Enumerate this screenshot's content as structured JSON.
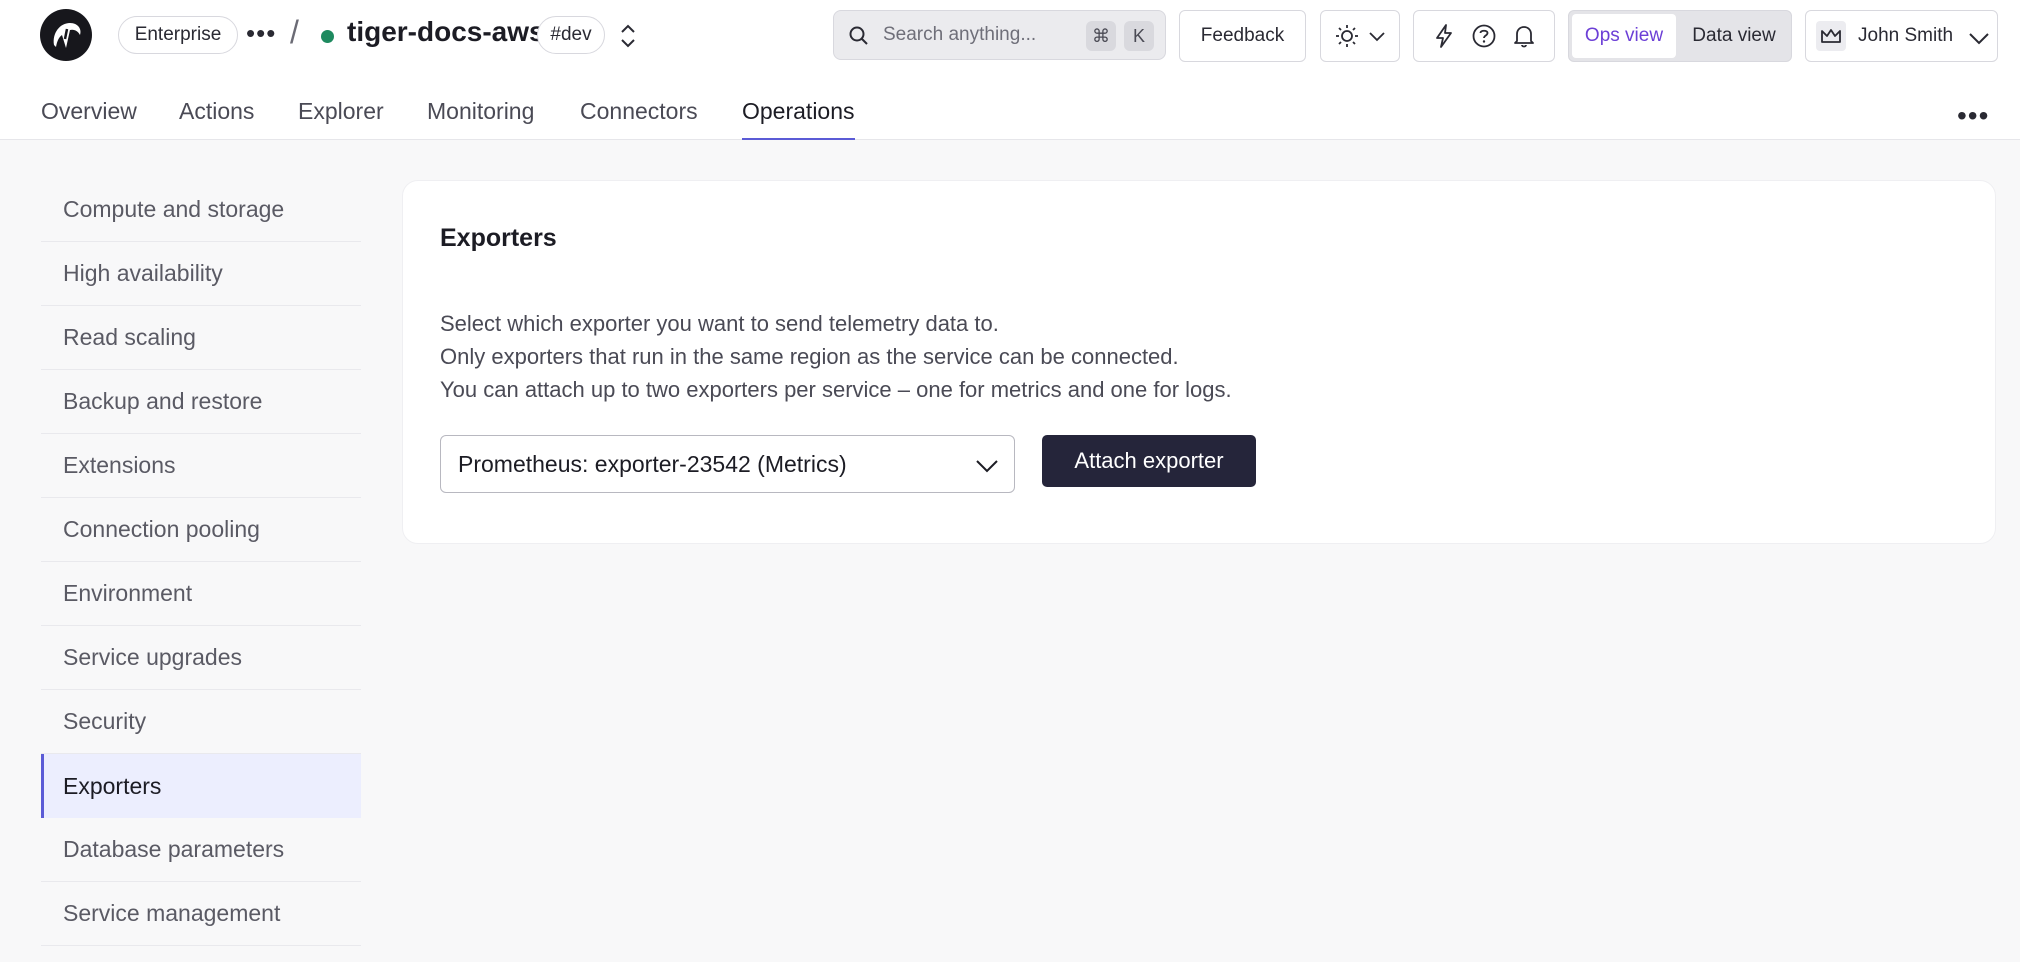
{
  "header": {
    "org_badge": "Enterprise",
    "service_name": "tiger-docs-aws",
    "service_status_color": "#1e8a5f",
    "env_badge": "#dev",
    "search_placeholder": "Search anything...",
    "search_shortcut_mod": "⌘",
    "search_shortcut_key": "K",
    "feedback_label": "Feedback",
    "view_toggle": {
      "ops_label": "Ops view",
      "data_label": "Data view",
      "active": "Ops view"
    },
    "user_name": "John Smith"
  },
  "tabs": [
    {
      "label": "Overview"
    },
    {
      "label": "Actions"
    },
    {
      "label": "Explorer"
    },
    {
      "label": "Monitoring"
    },
    {
      "label": "Connectors"
    },
    {
      "label": "Operations",
      "active": true
    }
  ],
  "sidebar": {
    "items": [
      {
        "label": "Compute and storage"
      },
      {
        "label": "High availability"
      },
      {
        "label": "Read scaling"
      },
      {
        "label": "Backup and restore"
      },
      {
        "label": "Extensions"
      },
      {
        "label": "Connection pooling"
      },
      {
        "label": "Environment"
      },
      {
        "label": "Service upgrades"
      },
      {
        "label": "Security"
      },
      {
        "label": "Exporters",
        "active": true
      },
      {
        "label": "Database parameters"
      },
      {
        "label": "Service management"
      }
    ]
  },
  "main": {
    "title": "Exporters",
    "description": [
      "Select which exporter you want to send telemetry data to.",
      "Only exporters that run in the same region as the service can be connected.",
      "You can attach up to two exporters per service – one for metrics and one for logs."
    ],
    "exporter_select_value": "Prometheus: exporter-23542 (Metrics)",
    "attach_button_label": "Attach exporter"
  },
  "colors": {
    "accent": "#5b5bd6",
    "ops_view_text": "#6c3fd6",
    "primary_button": "#25253a"
  }
}
